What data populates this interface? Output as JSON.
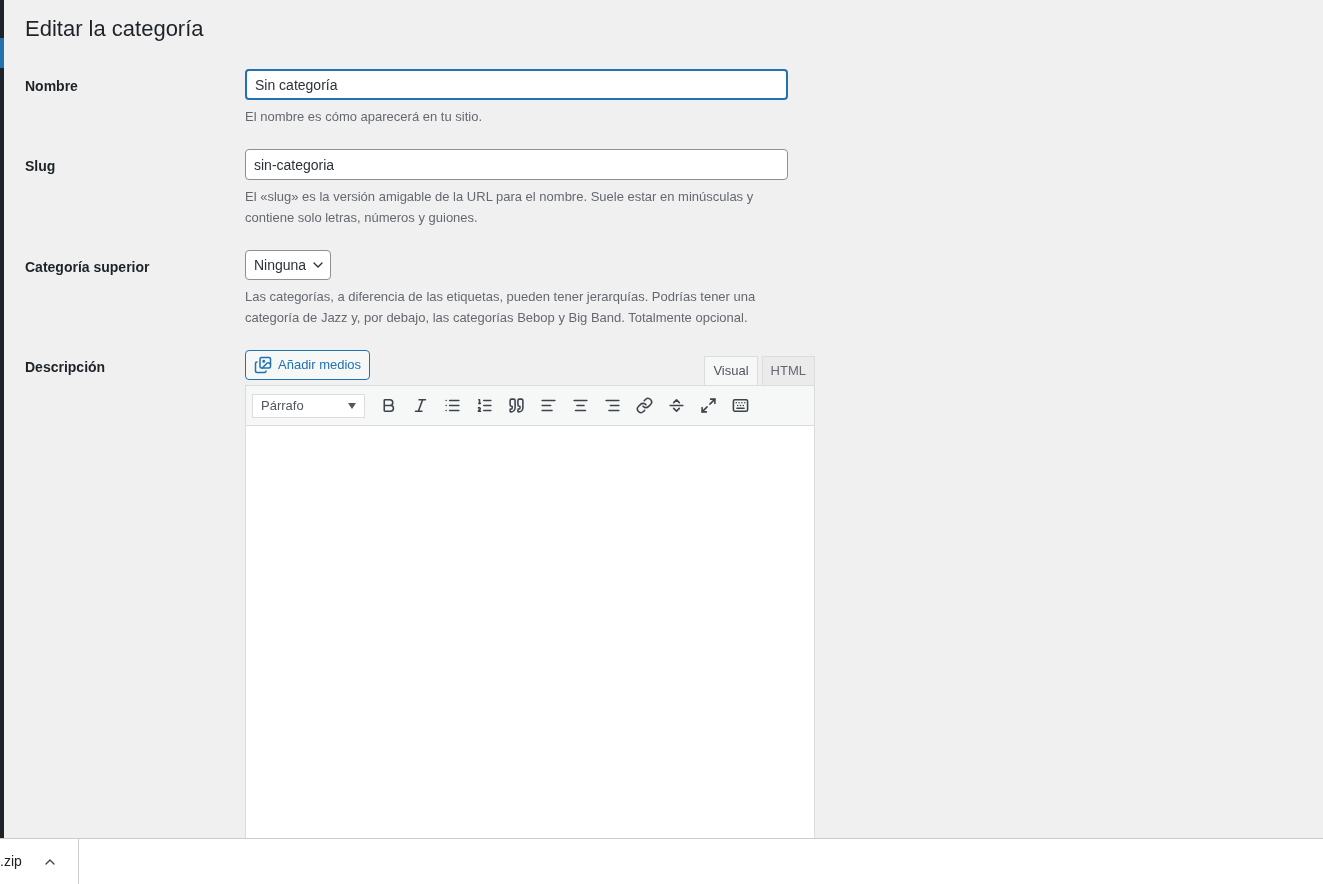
{
  "page_title": "Editar la categoría",
  "fields": [
    {
      "kind": "text",
      "label": "Nombre",
      "value": "Sin categoría",
      "focused": true,
      "description": "El nombre es cómo aparecerá en tu sitio."
    },
    {
      "kind": "text",
      "label": "Slug",
      "value": "sin-categoria",
      "focused": false,
      "description": "El «slug» es la versión amigable de la URL para el nombre. Suele estar en minúsculas y contiene solo letras, números y guiones."
    },
    {
      "kind": "select",
      "label": "Categoría superior",
      "value": "Ninguna",
      "description": "Las categorías, a diferencia de las etiquetas, pueden tener jerarquías. Podrías tener una categoría de Jazz y, por debajo, las categorías Bebop y Big Band. Totalmente opcional."
    },
    {
      "kind": "editor",
      "label": "Descripción",
      "media_button": "Añadir medios",
      "tabs": [
        {
          "label": "Visual",
          "selected": true
        },
        {
          "label": "HTML",
          "selected": false
        }
      ],
      "format": "Párrafo"
    }
  ],
  "download_bar": {
    "file": ".zip"
  }
}
